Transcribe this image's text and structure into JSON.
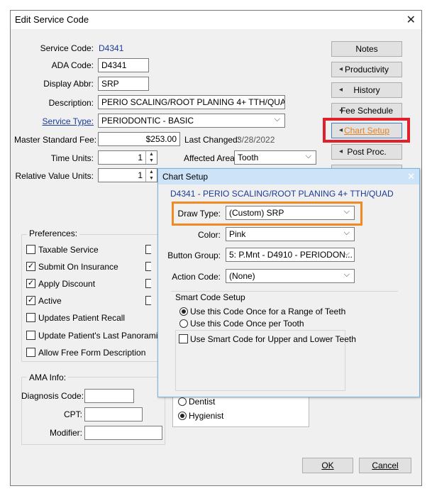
{
  "window": {
    "title": "Edit Service Code",
    "close_label": "✕"
  },
  "fields": {
    "service_code_label": "Service Code:",
    "service_code_value": "D4341",
    "ada_code_label": "ADA Code:",
    "ada_code_value": "D4341",
    "display_abbr_label": "Display Abbr:",
    "display_abbr_value": "SRP",
    "description_label": "Description:",
    "description_value": "PERIO SCALING/ROOT PLANING 4+ TTH/QUAD",
    "service_type_label": "Service Type:",
    "service_type_value": "PERIODONTIC - BASIC",
    "master_fee_label": "Master Standard Fee:",
    "master_fee_value": "$253.00",
    "last_changed_label": "Last Changed:",
    "last_changed_value": "3/28/2022",
    "time_units_label": "Time Units:",
    "time_units_value": "1",
    "affected_area_label": "Affected Area:",
    "affected_area_value": "Tooth",
    "rvu_label": "Relative Value Units:",
    "rvu_value": "1"
  },
  "buttons": {
    "notes": "Notes",
    "productivity": "Productivity",
    "history": "History",
    "fee_schedule": "Fee Schedule",
    "chart_setup": "Chart Setup",
    "post_proc": "Post Proc.",
    "ok": "OK",
    "cancel": "Cancel"
  },
  "preferences": {
    "title": "Preferences:",
    "items": [
      {
        "label": "Taxable Service",
        "checked": false
      },
      {
        "label": "Submit On Insurance",
        "checked": true
      },
      {
        "label": "Apply Discount",
        "checked": true
      },
      {
        "label": "Active",
        "checked": true
      },
      {
        "label": "Updates Patient Recall",
        "checked": false
      },
      {
        "label": "Update Patient's Last Panoramic",
        "checked": false
      },
      {
        "label": "Allow Free Form Description",
        "checked": false
      }
    ]
  },
  "ama": {
    "title": "AMA Info:",
    "diagnosis_label": "Diagnosis Code:",
    "cpt_label": "CPT:",
    "modifier_label": "Modifier:"
  },
  "provider": {
    "dentist": "Dentist",
    "hygienist": "Hygienist",
    "selected": "hygienist"
  },
  "chart_setup": {
    "title": "Chart Setup",
    "close": "✕",
    "header": "D4341 - PERIO SCALING/ROOT PLANING 4+ TTH/QUAD",
    "draw_type_label": "Draw Type:",
    "draw_type_value": "(Custom) SRP",
    "color_label": "Color:",
    "color_value": "Pink",
    "button_group_label": "Button Group:",
    "button_group_value": "5: P.Mnt - D4910 - PERIODON...",
    "action_code_label": "Action Code:",
    "action_code_value": "(None)",
    "smart_title": "Smart Code Setup",
    "radio_range": "Use this Code Once for a Range of Teeth",
    "radio_per_tooth": "Use this Code Once per Tooth",
    "smart_upper_lower": "Use Smart Code for Upper and Lower Teeth"
  },
  "colors": {
    "highlight_red": "#e0202a",
    "highlight_orange": "#f08a24",
    "accent_blue": "#1a3a9a",
    "chart_btn_text": "#e0832a"
  }
}
